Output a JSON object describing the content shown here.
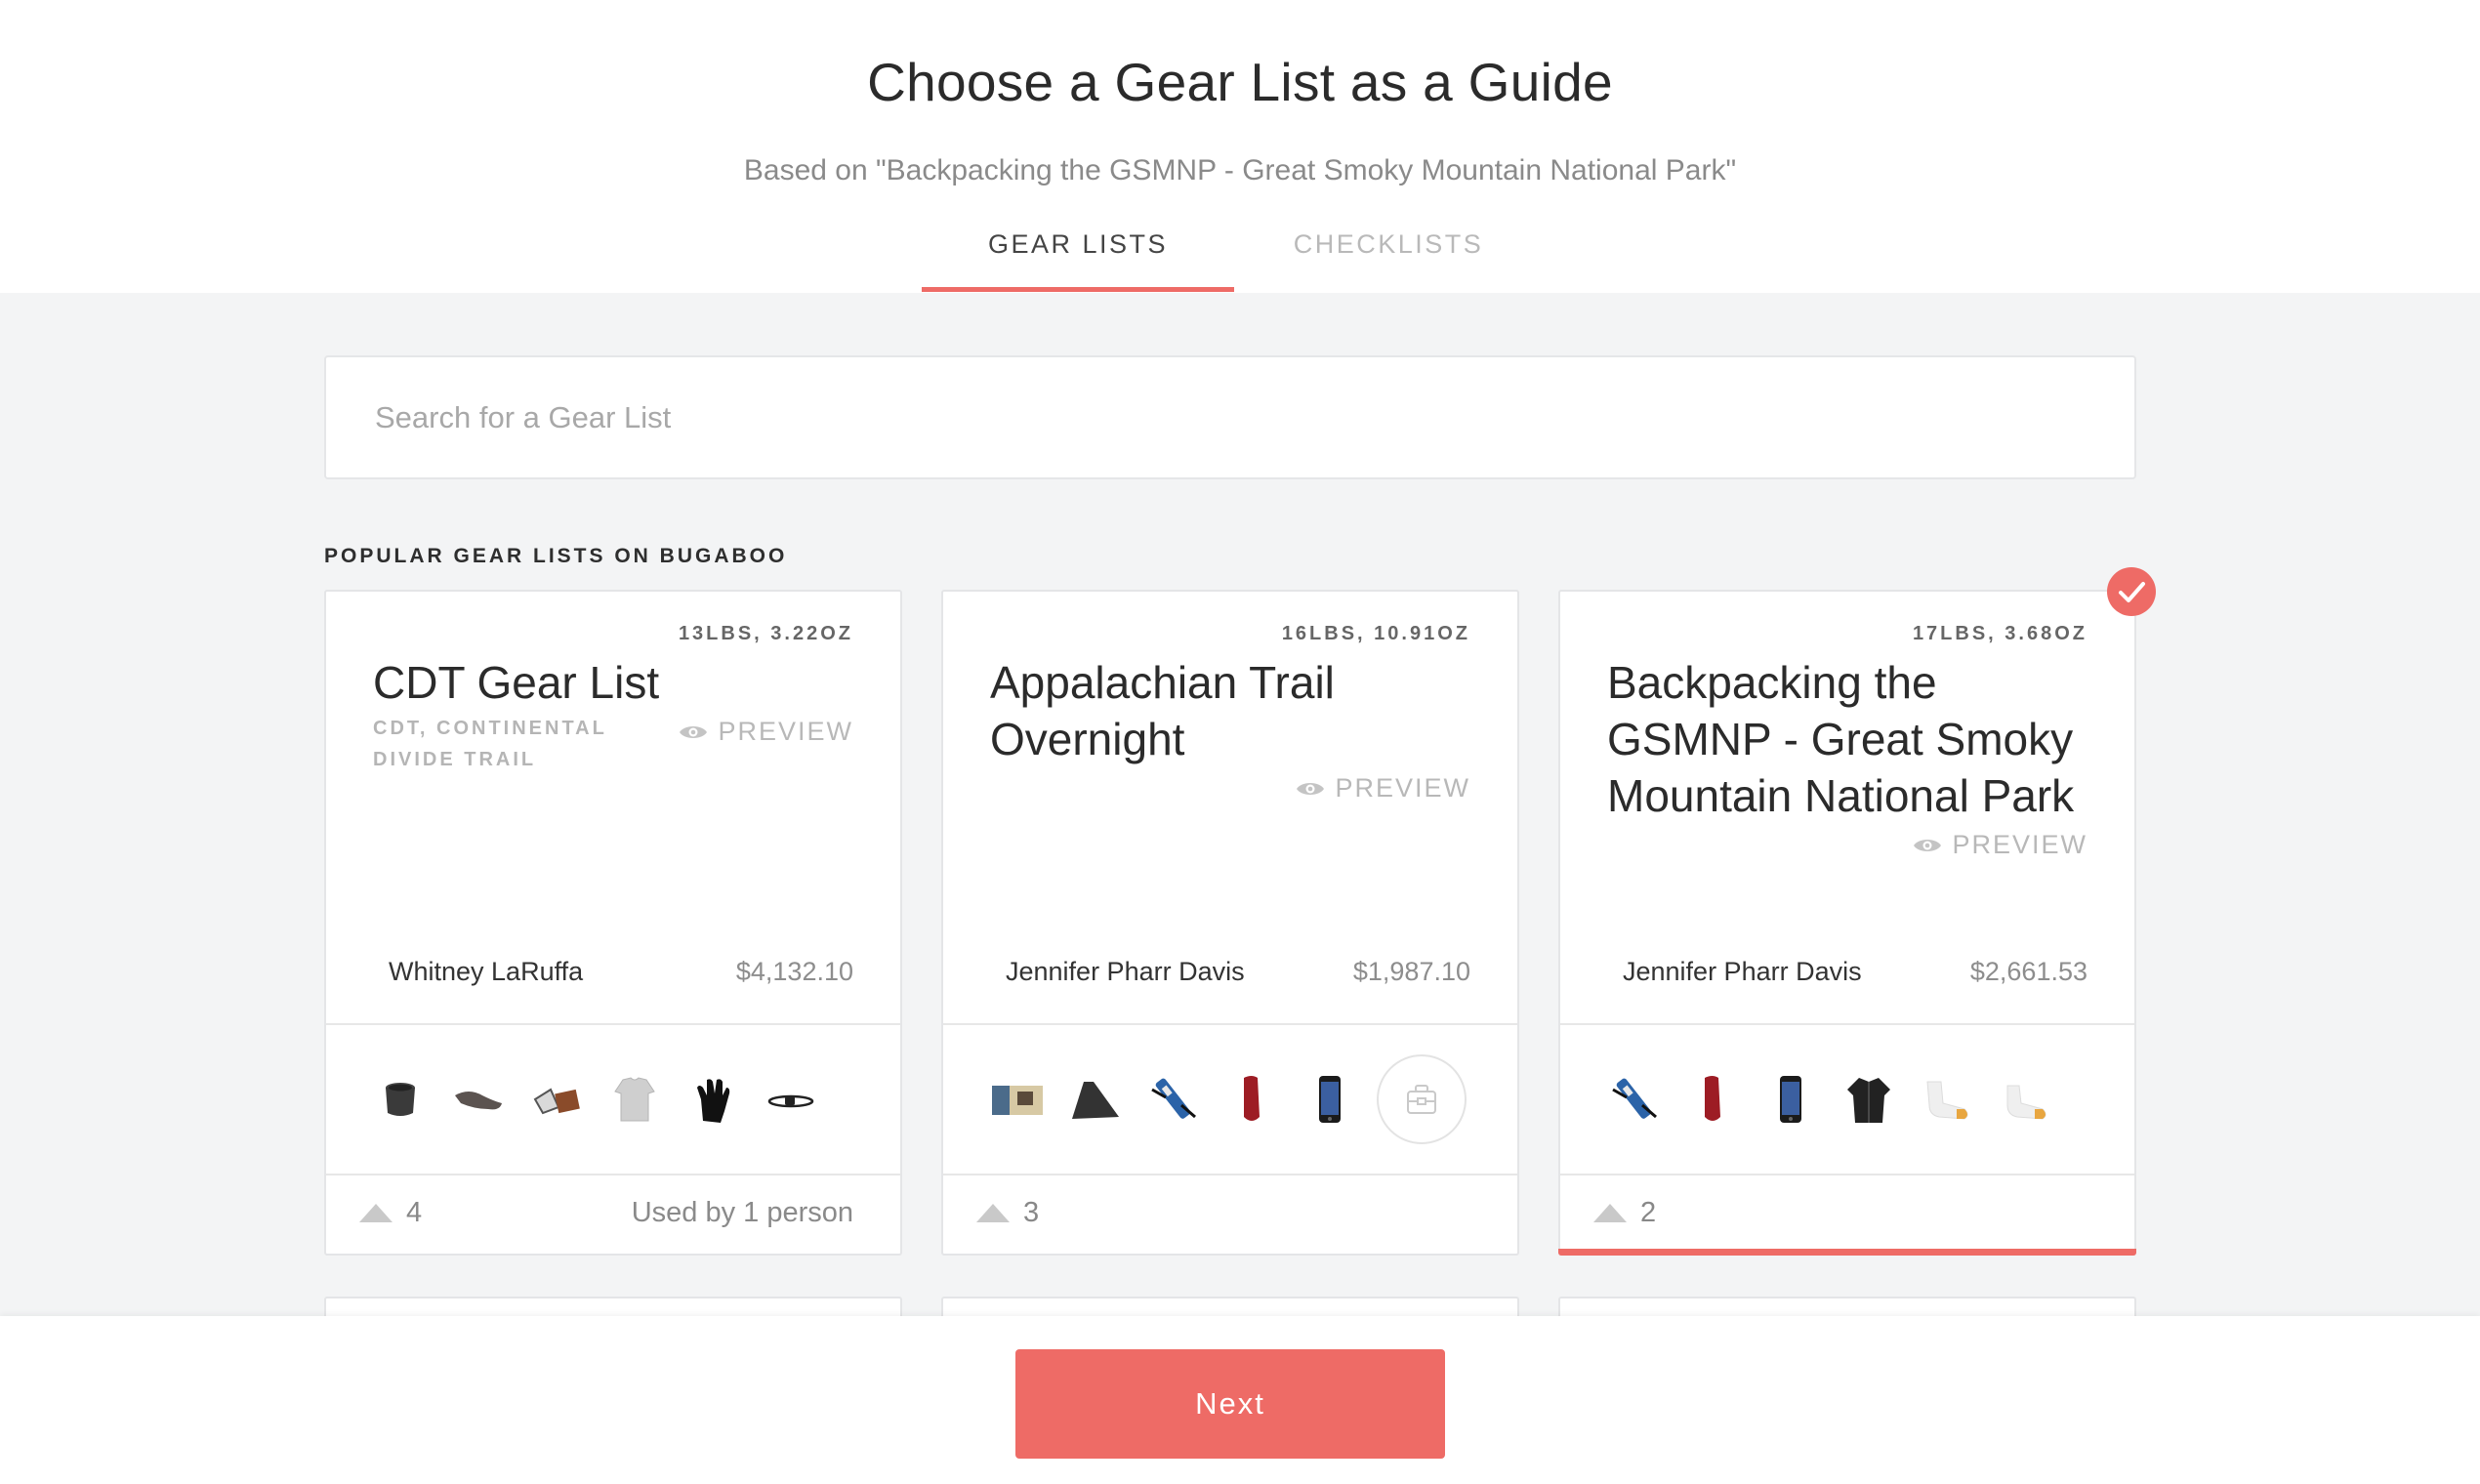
{
  "header": {
    "title": "Choose a Gear List as a Guide",
    "subtitle": "Based on \"Backpacking the GSMNP - Great Smoky Mountain National Park\"",
    "tabs": [
      {
        "label": "GEAR LISTS",
        "active": true
      },
      {
        "label": "CHECKLISTS",
        "active": false
      }
    ]
  },
  "search": {
    "placeholder": "Search for a Gear List",
    "value": ""
  },
  "section_label": "POPULAR GEAR LISTS ON BUGABOO",
  "cards": [
    {
      "weight": "13LBS, 3.22OZ",
      "title": "CDT Gear List",
      "tags": "CDT, CONTINENTAL DIVIDE TRAIL",
      "preview_label": "PREVIEW",
      "author": "Whitney LaRuffa",
      "price": "$4,132.10",
      "votes": "4",
      "used_by": "Used by 1 person",
      "selected": false,
      "item_icons": [
        "cup-icon",
        "saddle-icon",
        "stuff-sack-icon",
        "base-layer-shirt-icon",
        "glove-icon",
        "headlamp-icon"
      ]
    },
    {
      "weight": "16LBS, 10.91OZ",
      "title": "Appalachian Trail Overnight",
      "preview_label": "PREVIEW",
      "author": "Jennifer Pharr Davis",
      "price": "$1,987.10",
      "votes": "3",
      "selected": false,
      "item_icons": [
        "map-icon",
        "sleeping-pad-icon",
        "water-filter-icon",
        "sleeping-bag-icon",
        "phone-icon",
        "more-items-icon"
      ]
    },
    {
      "weight": "17LBS, 3.68OZ",
      "title": "Backpacking the GSMNP - Great Smoky Mountain National Park",
      "preview_label": "PREVIEW",
      "author": "Jennifer Pharr Davis",
      "price": "$2,661.53",
      "votes": "2",
      "selected": true,
      "item_icons": [
        "water-filter-icon",
        "sleeping-bag-icon",
        "phone-icon",
        "jacket-icon",
        "sock-icon",
        "sock-icon"
      ]
    }
  ],
  "footer": {
    "next_label": "Next"
  },
  "colors": {
    "accent": "#ee6b66",
    "background": "#f3f4f5"
  }
}
